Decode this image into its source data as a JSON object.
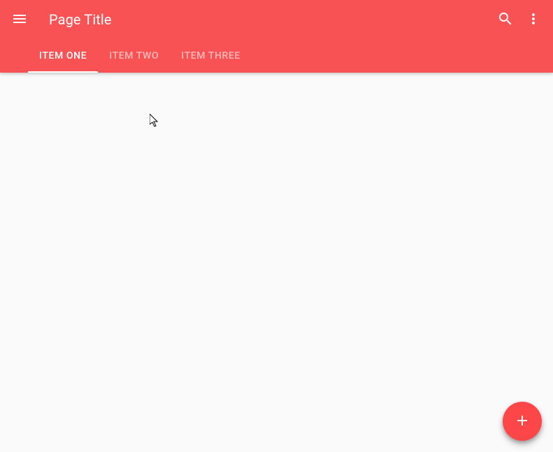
{
  "header": {
    "title": "Page Title"
  },
  "tabs": [
    {
      "label": "Item One"
    },
    {
      "label": "Item Two"
    },
    {
      "label": "Item Three"
    }
  ],
  "activeTab": 0,
  "colors": {
    "primary": "#f85254",
    "fab": "#fc4648"
  }
}
